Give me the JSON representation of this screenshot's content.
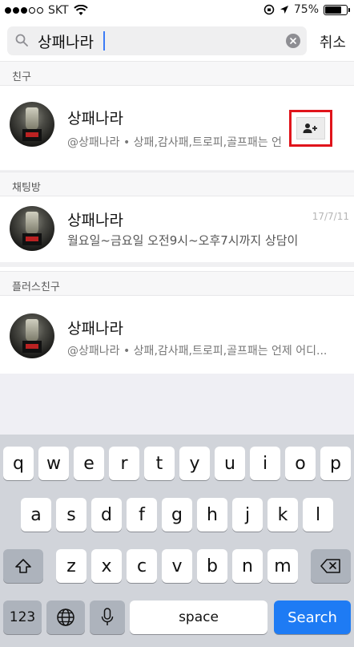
{
  "status_bar": {
    "carrier": "SKT",
    "battery_text": "75%",
    "battery_level": 0.75
  },
  "search": {
    "query": "상패나라",
    "cancel_label": "취소"
  },
  "sections": {
    "friends": {
      "header": "친구",
      "item": {
        "name": "상패나라",
        "subtitle": "@상패나라 • 상패,감사패,트로피,골프패는 언"
      }
    },
    "chatrooms": {
      "header": "채팅방",
      "item": {
        "name": "상패나라",
        "subtitle": "월요일~금요일 오전9시~오후7시까지 상담이",
        "date": "17/7/11"
      }
    },
    "plus_friends": {
      "header": "플러스친구",
      "item": {
        "name": "상패나라",
        "subtitle": "@상패나라 • 상패,감사패,트로피,골프패는 언제 어디..."
      }
    }
  },
  "keyboard": {
    "row1": [
      "q",
      "w",
      "e",
      "r",
      "t",
      "y",
      "u",
      "i",
      "o",
      "p"
    ],
    "row2": [
      "a",
      "s",
      "d",
      "f",
      "g",
      "h",
      "j",
      "k",
      "l"
    ],
    "row3": [
      "z",
      "x",
      "c",
      "v",
      "b",
      "n",
      "m"
    ],
    "numbers_label": "123",
    "space_label": "space",
    "search_label": "Search"
  },
  "colors": {
    "accent": "#1e7bf4",
    "highlight_border": "#e0141b"
  }
}
